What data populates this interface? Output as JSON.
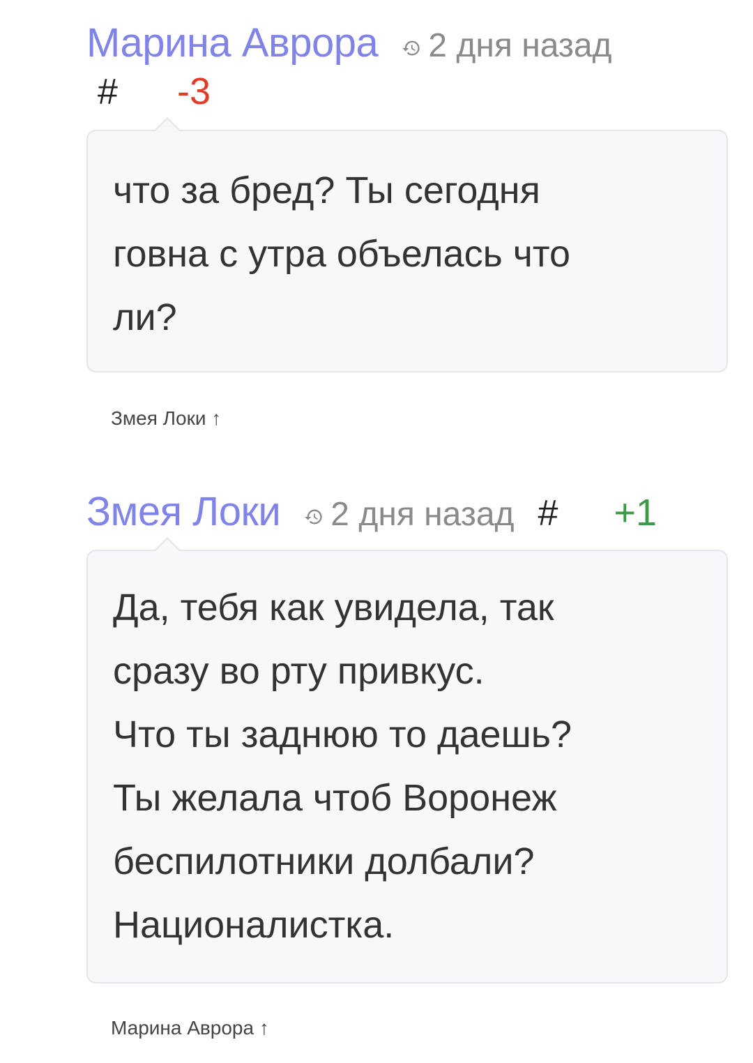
{
  "comments": [
    {
      "author": "Марина Аврора",
      "time": "2 дня назад",
      "hash": "#",
      "score": "-3",
      "text_lines": [
        "что за бред? Ты сегодня",
        "говна с утра объелась что",
        "ли?"
      ],
      "reply_to": "Змея Локи ↑"
    },
    {
      "author": "Змея Локи",
      "time": "2 дня назад",
      "hash": "#",
      "score": "+1",
      "text_lines": [
        "Да, тебя как увидела, так",
        "сразу во рту привкус.",
        "Что ты заднюю то даешь?",
        "Ты желала чтоб Воронеж",
        "беспилотники долбали?",
        "Националистка."
      ],
      "reply_to": "Марина Аврора ↑"
    }
  ],
  "colors": {
    "author": "#8083e8",
    "negative_score": "#e23b26",
    "positive_score": "#3d9a46",
    "timestamp": "#8a8a8a",
    "bubble_bg": "#f7f8fa",
    "bubble_border": "#e3e5ea"
  },
  "icons": {
    "time": "history-clock-icon"
  }
}
